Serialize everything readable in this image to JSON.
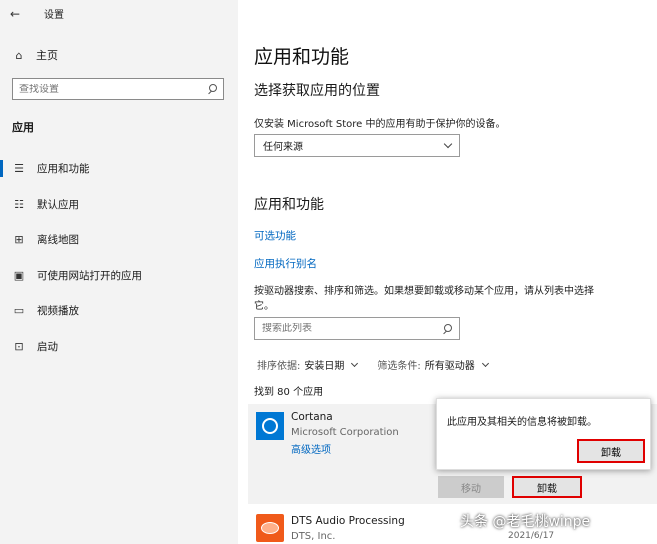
{
  "window": {
    "title": "设置"
  },
  "sidebar": {
    "home": "主页",
    "search_placeholder": "查找设置",
    "section": "应用",
    "items": [
      {
        "label": "应用和功能",
        "icon": "apps-features-icon"
      },
      {
        "label": "默认应用",
        "icon": "default-apps-icon"
      },
      {
        "label": "离线地图",
        "icon": "offline-maps-icon"
      },
      {
        "label": "可使用网站打开的应用",
        "icon": "apps-for-websites-icon"
      },
      {
        "label": "视频播放",
        "icon": "video-playback-icon"
      },
      {
        "label": "启动",
        "icon": "startup-icon"
      }
    ]
  },
  "main": {
    "title": "应用和功能",
    "choose_location": {
      "heading": "选择获取应用的位置",
      "description": "仅安装 Microsoft Store 中的应用有助于保护你的设备。",
      "selected": "任何来源"
    },
    "apps_features": {
      "heading": "应用和功能",
      "optional_features": "可选功能",
      "app_aliases": "应用执行别名",
      "description": "按驱动器搜索、排序和筛选。如果想要卸载或移动某个应用，请从列表中选择它。",
      "search_placeholder": "搜索此列表",
      "sort_label": "排序依据:",
      "sort_value": "安装日期",
      "filter_label": "筛选条件:",
      "filter_value": "所有驱动器",
      "found": "找到 80 个应用"
    },
    "apps": [
      {
        "name": "Cortana",
        "publisher": "Microsoft Corporation",
        "advanced": "高级选项",
        "move": "移动",
        "uninstall": "卸载"
      },
      {
        "name": "DTS Audio Processing",
        "publisher": "DTS, Inc.",
        "date": "2021/6/17"
      }
    ],
    "flyout": {
      "message": "此应用及其相关的信息将被卸载。",
      "button": "卸载"
    }
  },
  "watermark": "头条 @老毛桃winpe",
  "colors": {
    "accent": "#0067c0",
    "highlight": "#e00000"
  }
}
